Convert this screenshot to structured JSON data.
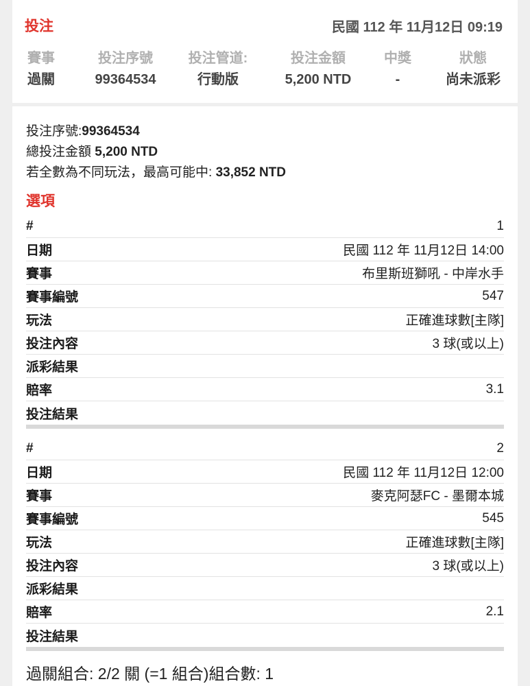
{
  "header": {
    "title": "投注",
    "datetime": "民國 112 年 11月12日 09:19"
  },
  "overview": {
    "columns": [
      {
        "label": "賽事",
        "value": "過關"
      },
      {
        "label": "投注序號",
        "value": "99364534"
      },
      {
        "label": "投注管道:",
        "value": "行動版"
      },
      {
        "label": "投注金額",
        "value": "5,200 NTD"
      },
      {
        "label": "中獎",
        "value": "-"
      },
      {
        "label": "狀態",
        "value": "尚未派彩"
      }
    ]
  },
  "summary": {
    "serial_label": "投注序號:",
    "serial_value": "99364534",
    "total_label": "總投注金額 ",
    "total_value": "5,200 NTD",
    "max_label": "若全數為不同玩法，最高可能中: ",
    "max_value": "33,852 NTD"
  },
  "selections_title": "選項",
  "selections": [
    {
      "rows": [
        {
          "key": "#",
          "value": "1"
        },
        {
          "key": "日期",
          "value": "民國 112 年 11月12日 14:00"
        },
        {
          "key": "賽事",
          "value": "布里斯班獅吼 - 中岸水手"
        },
        {
          "key": "賽事編號",
          "value": "547"
        },
        {
          "key": "玩法",
          "value": "正確進球數[主隊]"
        },
        {
          "key": "投注內容",
          "value": "3 球(或以上)"
        },
        {
          "key": "派彩結果",
          "value": ""
        },
        {
          "key": "賠率",
          "value": "3.1"
        },
        {
          "key": "投注結果",
          "value": ""
        }
      ]
    },
    {
      "rows": [
        {
          "key": "#",
          "value": "2"
        },
        {
          "key": "日期",
          "value": "民國 112 年 11月12日 12:00"
        },
        {
          "key": "賽事",
          "value": "麥克阿瑟FC - 墨爾本城"
        },
        {
          "key": "賽事編號",
          "value": "545"
        },
        {
          "key": "玩法",
          "value": "正確進球數[主隊]"
        },
        {
          "key": "投注內容",
          "value": "3 球(或以上)"
        },
        {
          "key": "派彩結果",
          "value": ""
        },
        {
          "key": "賠率",
          "value": "2.1"
        },
        {
          "key": "投注結果",
          "value": ""
        }
      ]
    }
  ],
  "footer": "過關組合: 2/2 關 (=1 組合)組合數: 1"
}
